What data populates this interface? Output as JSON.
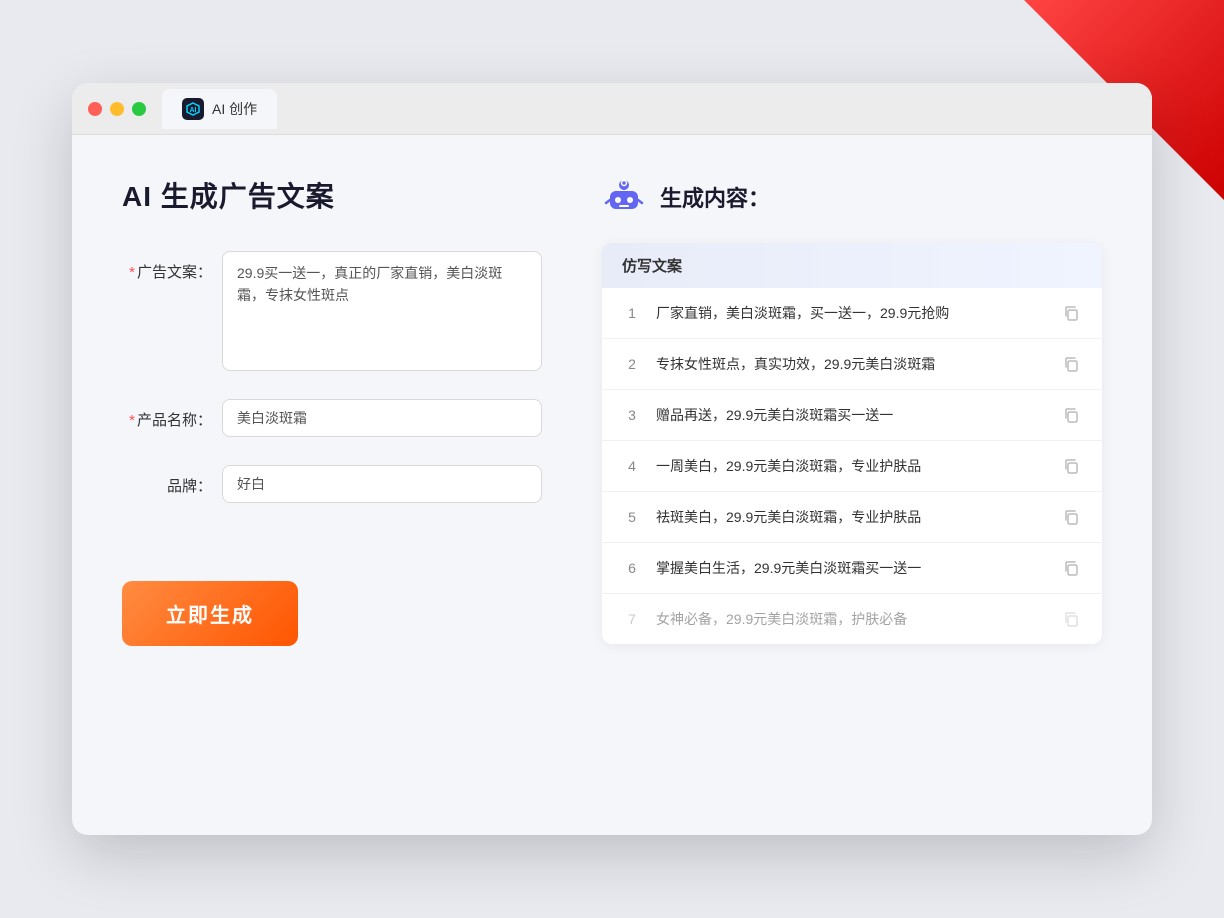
{
  "browser": {
    "tab_label": "AI 创作"
  },
  "page": {
    "title": "AI 生成广告文案",
    "result_title": "生成内容："
  },
  "form": {
    "ad_copy_label": "广告文案：",
    "ad_copy_required": "*",
    "ad_copy_value": "29.9买一送一，真正的厂家直销，美白淡斑霜，专抹女性斑点",
    "product_name_label": "产品名称：",
    "product_name_required": "*",
    "product_name_value": "美白淡斑霜",
    "brand_label": "品牌：",
    "brand_value": "好白",
    "generate_btn_label": "立即生成"
  },
  "results": {
    "table_header": "仿写文案",
    "items": [
      {
        "num": "1",
        "text": "厂家直销，美白淡斑霜，买一送一，29.9元抢购",
        "faded": false
      },
      {
        "num": "2",
        "text": "专抹女性斑点，真实功效，29.9元美白淡斑霜",
        "faded": false
      },
      {
        "num": "3",
        "text": "赠品再送，29.9元美白淡斑霜买一送一",
        "faded": false
      },
      {
        "num": "4",
        "text": "一周美白，29.9元美白淡斑霜，专业护肤品",
        "faded": false
      },
      {
        "num": "5",
        "text": "祛斑美白，29.9元美白淡斑霜，专业护肤品",
        "faded": false
      },
      {
        "num": "6",
        "text": "掌握美白生活，29.9元美白淡斑霜买一送一",
        "faded": false
      },
      {
        "num": "7",
        "text": "女神必备，29.9元美白淡斑霜，护肤必备",
        "faded": true
      }
    ]
  }
}
